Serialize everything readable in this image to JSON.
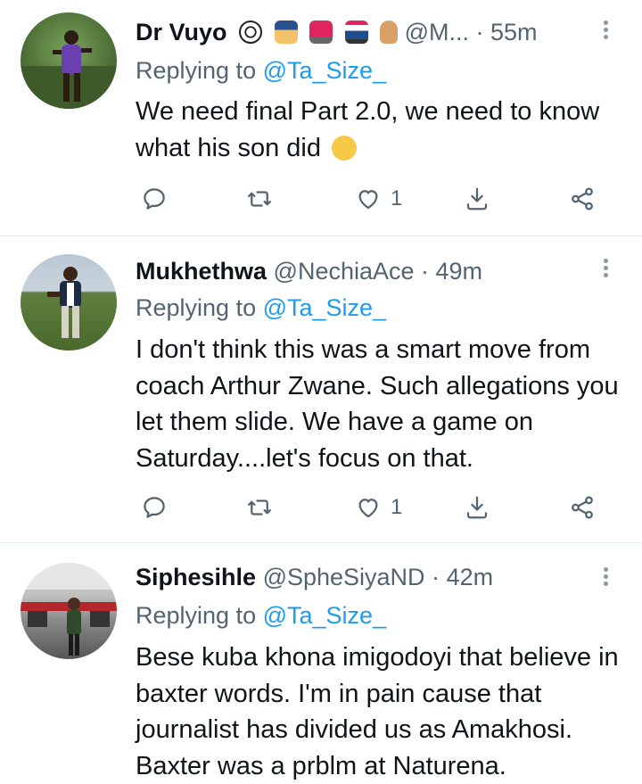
{
  "tweets": [
    {
      "name": "Dr Vuyo",
      "handle": "@M...",
      "time": "· 55m",
      "replying_prefix": "Replying to",
      "replying_to": "@Ta_Size_",
      "text": "We need final Part 2.0, we need to know what his son did",
      "like_count": "1",
      "name_emojis": [
        "soccer-ball",
        "police-officer",
        "police-light",
        "police-car",
        "victory-hand"
      ],
      "text_emoji": "face-with-hand-over-mouth"
    },
    {
      "name": "Mukhethwa",
      "handle": "@NechiaAce",
      "time": "· 49m",
      "replying_prefix": "Replying to",
      "replying_to": "@Ta_Size_",
      "text": "I don't think this was a smart move from coach Arthur Zwane.  Such allegations you let them slide. We have a game on Saturday....let's focus on that.",
      "like_count": "1"
    },
    {
      "name": "Siphesihle",
      "handle": "@SpheSiyaND",
      "time": "· 42m",
      "replying_prefix": "Replying to",
      "replying_to": "@Ta_Size_",
      "text": "Bese kuba khona imigodoyi that believe in baxter words. I'm in pain cause that journalist has divided us as Amakhosi. Baxter was a prblm at Naturena."
    }
  ],
  "colors": {
    "secondary_text": "#536471",
    "link": "#1d9bf0",
    "divider": "#e6ecf0"
  }
}
